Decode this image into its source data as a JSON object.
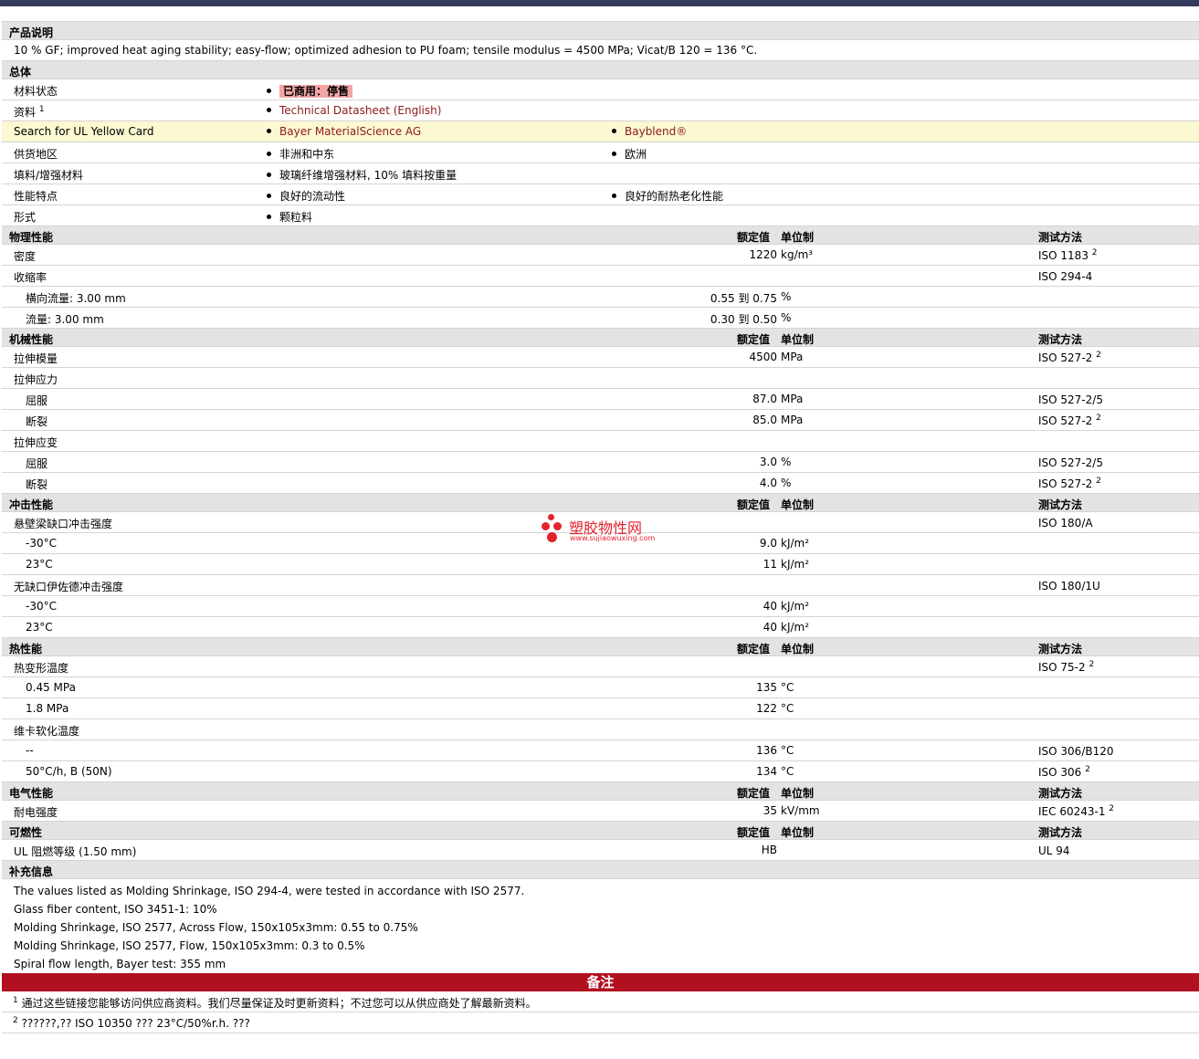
{
  "sections": {
    "desc_title": "产品说明",
    "desc_text": "10 % GF; improved heat aging stability; easy-flow; optimized adhesion to PU foam; tensile modulus = 4500 MPa; Vicat/B 120 = 136 °C.",
    "general": "总体",
    "physical": "物理性能",
    "mechanical": "机械性能",
    "impact": "冲击性能",
    "thermal": "热性能",
    "electrical": "电气性能",
    "flammability": "可燃性",
    "supplementary": "补充信息"
  },
  "headers": {
    "value": "额定值",
    "unit": "单位制",
    "test": "测试方法"
  },
  "general": {
    "status_label": "材料状态",
    "status_value": "已商用：停售",
    "docs_label": "资料",
    "docs_sup": "1",
    "docs_link": "Technical Datasheet (English)",
    "ul_label": "Search for UL Yellow Card",
    "ul_link1": "Bayer MaterialScience AG",
    "ul_link2": "Bayblend®",
    "region_label": "供货地区",
    "region1": "非洲和中东",
    "region2": "欧洲",
    "filler_label": "填料/增强材料",
    "filler_value": "玻璃纤维增强材料, 10% 填料按重量",
    "features_label": "性能特点",
    "feature1": "良好的流动性",
    "feature2": "良好的耐热老化性能",
    "form_label": "形式",
    "form_value": "颗粒料"
  },
  "physical": [
    {
      "label": "密度",
      "value": "1220",
      "unit": "kg/m³",
      "test": "ISO 1183",
      "sup": "2"
    },
    {
      "label": "收缩率",
      "value": "",
      "unit": "",
      "test": "ISO 294-4",
      "sup": ""
    },
    {
      "label": "横向流量: 3.00 mm",
      "value": "0.55 到  0.75",
      "unit": "%",
      "test": "",
      "sup": ""
    },
    {
      "label": "流量: 3.00 mm",
      "value": "0.30 到  0.50",
      "unit": "%",
      "test": "",
      "sup": ""
    }
  ],
  "mechanical": [
    {
      "label": "拉伸模量",
      "value": "4500",
      "unit": "MPa",
      "test": "ISO 527-2",
      "sup": "2"
    },
    {
      "label": "拉伸应力",
      "value": "",
      "unit": "",
      "test": "",
      "sup": ""
    },
    {
      "label": "屈服",
      "value": "87.0",
      "unit": "MPa",
      "test": "ISO 527-2/5",
      "sup": ""
    },
    {
      "label": "断裂",
      "value": "85.0",
      "unit": "MPa",
      "test": "ISO 527-2",
      "sup": "2"
    },
    {
      "label": "拉伸应变",
      "value": "",
      "unit": "",
      "test": "",
      "sup": ""
    },
    {
      "label": "屈服",
      "value": "3.0",
      "unit": "%",
      "test": "ISO 527-2/5",
      "sup": ""
    },
    {
      "label": "断裂",
      "value": "4.0",
      "unit": "%",
      "test": "ISO 527-2",
      "sup": "2"
    }
  ],
  "impact": [
    {
      "label": "悬壁梁缺口冲击强度",
      "value": "",
      "unit": "",
      "test": "ISO 180/A",
      "sup": ""
    },
    {
      "label": "-30°C",
      "value": "9.0",
      "unit": "kJ/m²",
      "test": "",
      "sup": ""
    },
    {
      "label": "23°C",
      "value": "11",
      "unit": "kJ/m²",
      "test": "",
      "sup": ""
    },
    {
      "label": "无缺口伊佐德冲击强度",
      "value": "",
      "unit": "",
      "test": "ISO 180/1U",
      "sup": ""
    },
    {
      "label": "-30°C",
      "value": "40",
      "unit": "kJ/m²",
      "test": "",
      "sup": ""
    },
    {
      "label": "23°C",
      "value": "40",
      "unit": "kJ/m²",
      "test": "",
      "sup": ""
    }
  ],
  "thermal": [
    {
      "label": "热变形温度",
      "value": "",
      "unit": "",
      "test": "ISO 75-2",
      "sup": "2"
    },
    {
      "label": "0.45 MPa",
      "value": "135",
      "unit": "°C",
      "test": "",
      "sup": ""
    },
    {
      "label": "1.8 MPa",
      "value": "122",
      "unit": "°C",
      "test": "",
      "sup": ""
    },
    {
      "label": "维卡软化温度",
      "value": "",
      "unit": "",
      "test": "",
      "sup": ""
    },
    {
      "label": "--",
      "value": "136",
      "unit": "°C",
      "test": "ISO 306/B120",
      "sup": ""
    },
    {
      "label": "50°C/h, B (50N)",
      "value": "134",
      "unit": "°C",
      "test": "ISO 306",
      "sup": "2"
    }
  ],
  "electrical": [
    {
      "label": "耐电强度",
      "value": "35",
      "unit": "kV/mm",
      "test": "IEC 60243-1",
      "sup": "2"
    }
  ],
  "flammability": [
    {
      "label": "UL 阻燃等级  (1.50 mm)",
      "value": "HB",
      "unit": "",
      "test": "UL 94",
      "sup": ""
    }
  ],
  "supplementary_notes": [
    "The values listed as Molding Shrinkage, ISO 294-4, were tested in accordance with ISO 2577.",
    "Glass fiber content, ISO 3451-1: 10%",
    "Molding Shrinkage, ISO 2577, Across Flow, 150x105x3mm: 0.55 to 0.75%",
    "Molding Shrinkage, ISO 2577, Flow, 150x105x3mm: 0.3 to 0.5%",
    "Spiral flow length, Bayer test: 355 mm"
  ],
  "remarks": {
    "title": "备注",
    "note1_num": "1",
    "note1": "通过这些链接您能够访问供应商资料。我们尽量保证及时更新资料；不过您可以从供应商处了解最新资料。",
    "note2_num": "2",
    "note2": "??????,?? ISO 10350 ??? 23°C/50%r.h. ???"
  },
  "watermark": {
    "brand": "塑胶物性网",
    "url": "www.sujiaowuxing.com"
  },
  "colors": {
    "topbar": "#323a5e",
    "section_bg": "#e3e3e3",
    "highlight_row": "#fbf8d2",
    "link": "#8b1a1a",
    "status_badge": "#f4a6a6",
    "remarks_bar": "#b01020",
    "watermark": "#e4232d"
  }
}
